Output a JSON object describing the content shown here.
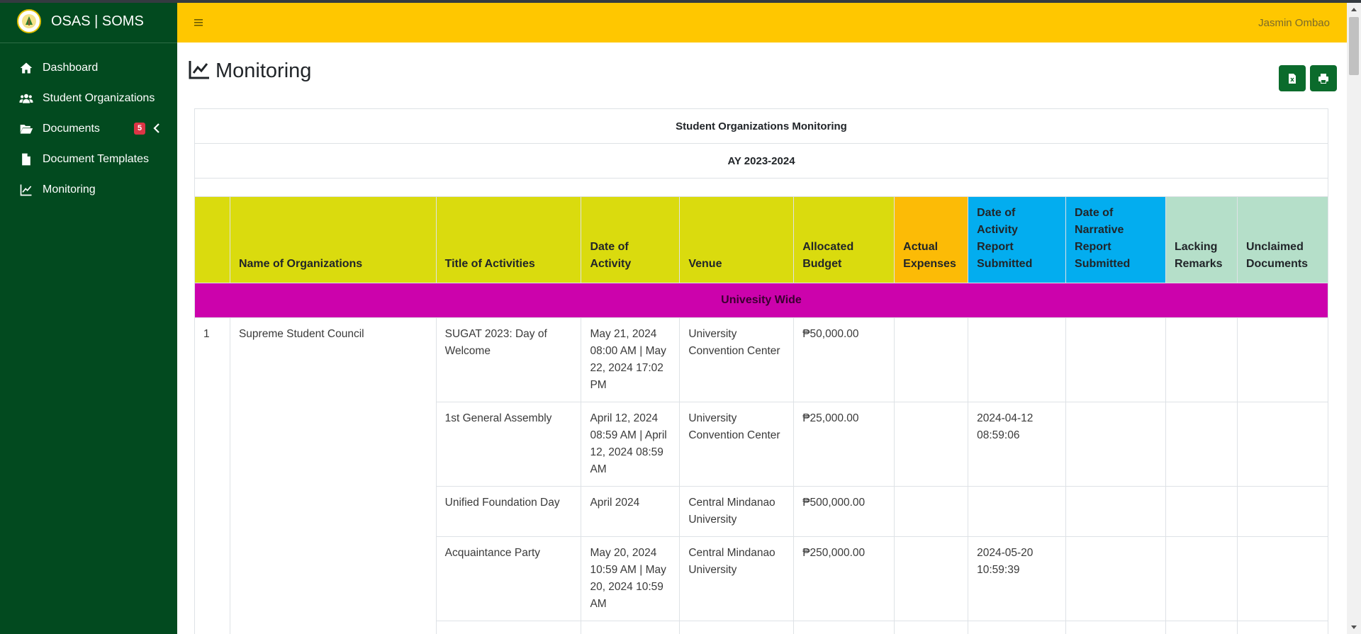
{
  "brand": {
    "title": "OSAS | SOMS"
  },
  "sidebar": {
    "items": [
      {
        "label": "Dashboard",
        "icon": "home-icon"
      },
      {
        "label": "Student Organizations",
        "icon": "users-icon"
      },
      {
        "label": "Documents",
        "icon": "folder-open-icon",
        "badge": "5"
      },
      {
        "label": "Document Templates",
        "icon": "file-icon"
      },
      {
        "label": "Monitoring",
        "icon": "line-chart-icon"
      }
    ]
  },
  "header": {
    "user": "Jasmin Ombao"
  },
  "page": {
    "title": "Monitoring"
  },
  "report": {
    "title": "Student Organizations Monitoring",
    "ay": "AY 2023-2024",
    "columns": [
      "",
      "Name of Organizations",
      "Title of Activities",
      "Date of Activity",
      "Venue",
      "Allocated Budget",
      "Actual Expenses",
      "Date of Activity Report Submitted",
      "Date of Narrative Report Submitted",
      "Lacking Remarks",
      "Unclaimed Documents"
    ],
    "section": "Univesity Wide",
    "org_number": "1",
    "org_name": "Supreme Student Council",
    "rows": [
      {
        "title": "SUGAT 2023: Day of Welcome",
        "date": "May 21, 2024 08:00 AM | May 22, 2024 17:02 PM",
        "venue": "University Convention Center",
        "budget": "₱50,000.00",
        "expenses": "",
        "activity_report": "",
        "narrative_report": "",
        "lacking": "",
        "unclaimed": ""
      },
      {
        "title": "1st General Assembly",
        "date": "April 12, 2024 08:59 AM | April 12, 2024 08:59 AM",
        "venue": "University Convention Center",
        "budget": "₱25,000.00",
        "expenses": "",
        "activity_report": "2024-04-12 08:59:06",
        "narrative_report": "",
        "lacking": "",
        "unclaimed": ""
      },
      {
        "title": "Unified Foundation Day",
        "date": "April 2024",
        "venue": "Central Mindanao University",
        "budget": "₱500,000.00",
        "expenses": "",
        "activity_report": "",
        "narrative_report": "",
        "lacking": "",
        "unclaimed": ""
      },
      {
        "title": "Acquaintance Party",
        "date": "May 20, 2024 10:59 AM | May 20, 2024 10:59 AM",
        "venue": "Central Mindanao University",
        "budget": "₱250,000.00",
        "expenses": "",
        "activity_report": "2024-05-20 10:59:39",
        "narrative_report": "",
        "lacking": "",
        "unclaimed": ""
      }
    ]
  }
}
